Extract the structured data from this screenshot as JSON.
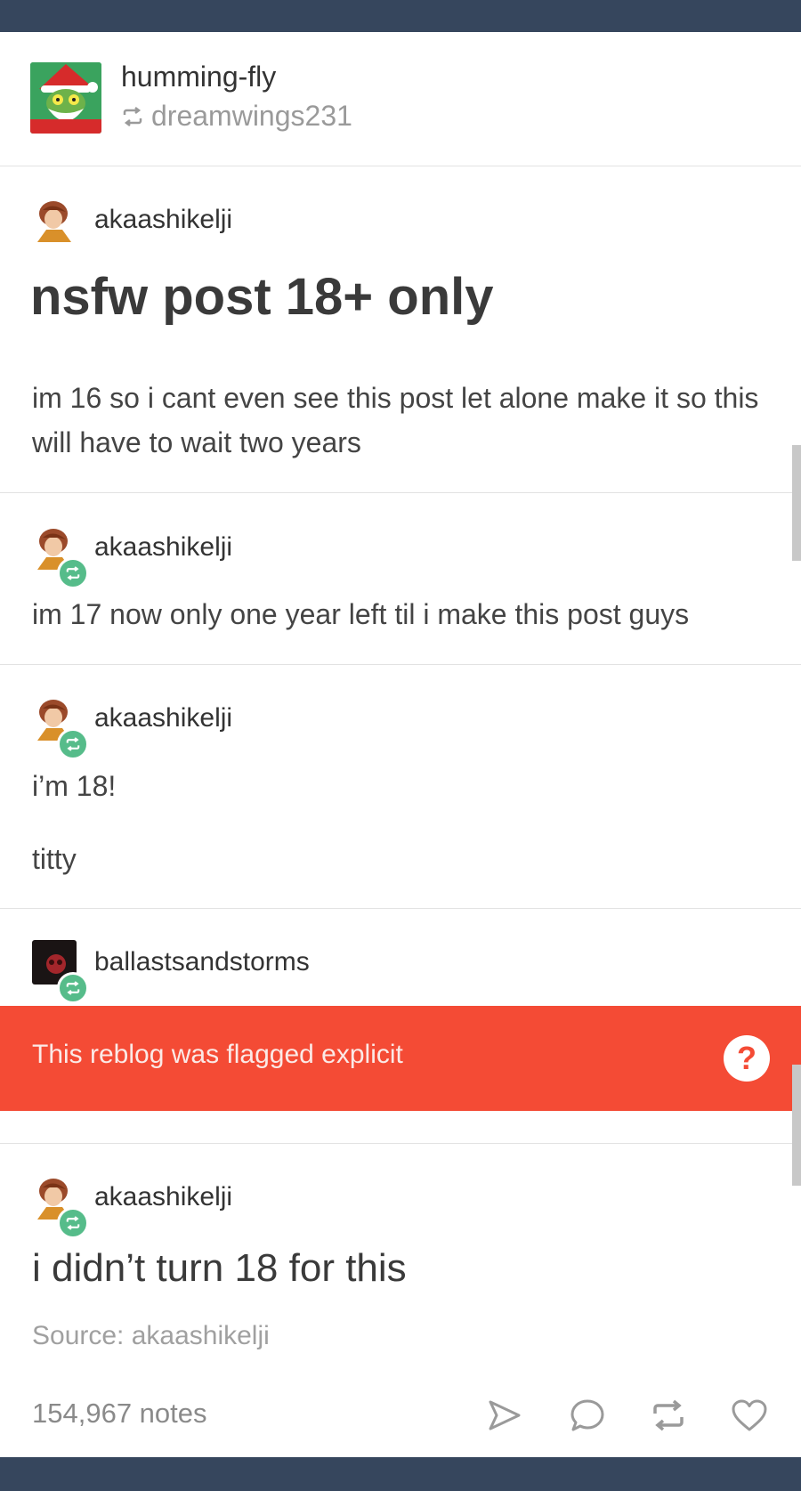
{
  "post": {
    "blog_name": "humming-fly",
    "reblogged_from": "dreamwings231",
    "reblog_icon": "reblog-icon"
  },
  "entries": [
    {
      "username": "akaashikelji"
    },
    {
      "username": "akaashikelji"
    },
    {
      "username": "akaashikelji"
    },
    {
      "username": "ballastsandstorms"
    },
    {
      "username": "akaashikelji"
    }
  ],
  "content": {
    "headline": "nsfw post 18+ only",
    "text1": "im 16 so i cant even see this post let alone make it so this will have to wait two years",
    "text2": "im 17 now only one year left til i make this post guys",
    "text3a": "i’m 18!",
    "text3b": "titty",
    "flag_text": "This reblog was flagged explicit",
    "flag_help": "?",
    "final_text": "i didn’t turn 18 for this",
    "source": "Source: akaashikelji"
  },
  "footer": {
    "notes": "154,967 notes",
    "actions": [
      "share-icon",
      "comment-icon",
      "reblog-icon",
      "heart-icon"
    ]
  },
  "colors": {
    "header_bar": "#36465d",
    "flag_bar": "#f44b35",
    "reblog_badge": "#56bc8a"
  }
}
